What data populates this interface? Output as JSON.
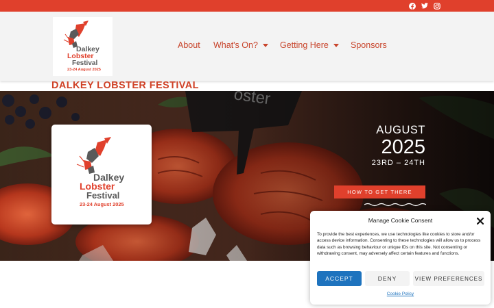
{
  "social": {
    "icons": [
      "facebook-icon",
      "twitter-icon",
      "instagram-icon"
    ]
  },
  "logo": {
    "line1": "Dalkey",
    "line2": "Lobster",
    "line3": "Festival",
    "dates": "23-24 August 2025"
  },
  "nav": {
    "items": [
      {
        "label": "About",
        "has_dropdown": false
      },
      {
        "label": "What's On?",
        "has_dropdown": true
      },
      {
        "label": "Getting Here",
        "has_dropdown": true
      },
      {
        "label": "Sponsors",
        "has_dropdown": false
      }
    ]
  },
  "site_title": "DALKEY LOBSTER FESTIVAL",
  "hero": {
    "month": "AUGUST",
    "year": "2025",
    "days": "23RD – 24TH",
    "cta": "HOW TO GET THERE",
    "sign_text": "oster"
  },
  "cookie": {
    "title": "Manage Cookie Consent",
    "body": "To provide the best experiences, we use technologies like cookies to store and/or access device information. Consenting to these technologies will allow us to process data such as browsing behaviour or unique IDs on this site. Not consenting or withdrawing consent, may adversely affect certain features and functions.",
    "accept": "ACCEPT",
    "deny": "DENY",
    "preferences": "VIEW PREFERENCES",
    "policy": "Cookie Policy"
  },
  "colors": {
    "brand_red": "#e0402c",
    "nav_text": "#c8452c",
    "accept_blue": "#1e73be",
    "logo_grey": "#5a5a5a"
  }
}
